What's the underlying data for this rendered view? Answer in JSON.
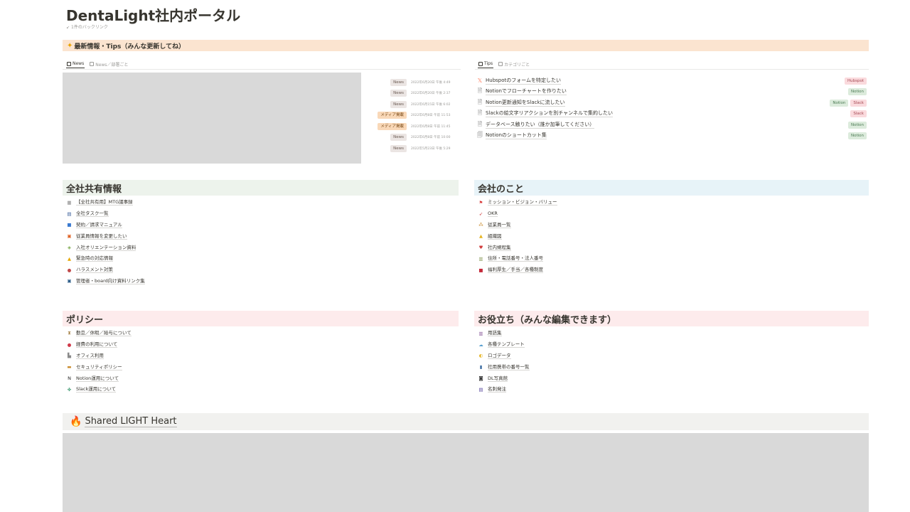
{
  "page": {
    "title": "DentaLight社内ポータル",
    "backlinks": "1件のバックリンク"
  },
  "callout": {
    "icon": "sparkle-icon",
    "text": "最新情報・Tips（みんな更新してね）"
  },
  "news": {
    "tabs": [
      {
        "label": "News",
        "active": true
      },
      {
        "label": "News／部署ごと",
        "active": false
      }
    ],
    "items": [
      {
        "tag": "News",
        "date": "2022年6月20日 午後 4:49"
      },
      {
        "tag": "News",
        "date": "2022年6月20日 午後 2:37"
      },
      {
        "tag": "News",
        "date": "2022年6月15日 午後 6:02"
      },
      {
        "tag": "メディア掲載",
        "date": "2022年6月8日 午前 11:53"
      },
      {
        "tag": "メディア掲載",
        "date": "2022年6月8日 午前 11:45"
      },
      {
        "tag": "News",
        "date": "2022年6月8日 午前 10:00"
      },
      {
        "tag": "News",
        "date": "2022年5月23日 午後 5:29"
      }
    ]
  },
  "tips": {
    "tabs": [
      {
        "label": "Tips",
        "active": true
      },
      {
        "label": "カテゴリごと",
        "active": false
      }
    ],
    "items": [
      {
        "title": "Hubspotのフォームを特定したい",
        "tags": [
          "Hubspot"
        ]
      },
      {
        "title": "Notionでフローチャートを作りたい",
        "tags": [
          "Notion"
        ]
      },
      {
        "title": "Notion更新通知をSlackに流したい",
        "tags": [
          "Notion",
          "Slack"
        ]
      },
      {
        "title": "Slackの絵文字リアクションを別チャンネルで集約したい",
        "tags": [
          "Slack"
        ]
      },
      {
        "title": "データベース触りたい（誰か加筆してください）",
        "tags": [
          "Notion"
        ]
      },
      {
        "title": "Notionのショートカット集",
        "tags": [
          "Notion"
        ]
      }
    ]
  },
  "sections": {
    "company_shared": {
      "title": "全社共有情報",
      "items": [
        "【全社共有用】MTG議事録",
        "全社タスク一覧",
        "契約／請求マニュアル",
        "従業員情報を変更したい",
        "入社オリエンテーション資料",
        "緊急時の対応情報",
        "ハラスメント対策",
        "管理者・board向け資料リンク集"
      ]
    },
    "about_company": {
      "title": "会社のこと",
      "items": [
        "ミッション・ビジョン・バリュー",
        "OKR",
        "従業員一覧",
        "組織図",
        "社内規程集",
        "住所・電話番号・法人番号",
        "福利厚生／手当／各種制度"
      ]
    },
    "policy": {
      "title": "ポリシー",
      "items": [
        "勤怠／休暇／給与について",
        "経費の利用について",
        "オフィス利用",
        "セキュリティポリシー",
        "Notion運用について",
        "Slack運用について"
      ]
    },
    "useful": {
      "title": "お役立ち（みんな編集できます）",
      "items": [
        "用語集",
        "各種テンプレート",
        "ロゴデータ",
        "社用携帯の番号一覧",
        "DL写真館",
        "名刺発注"
      ]
    }
  },
  "shared_heart": {
    "icon": "fire-icon",
    "title": "Shared LIGHT Heart"
  },
  "colors": {
    "callout_bg": "#fbe4d0",
    "green_bg": "#edf3ec",
    "blue_bg": "#e7f3f8",
    "pink_bg": "#fdebec",
    "gray_bg": "#f1f1ef",
    "image_placeholder": "#d9d9d9"
  }
}
